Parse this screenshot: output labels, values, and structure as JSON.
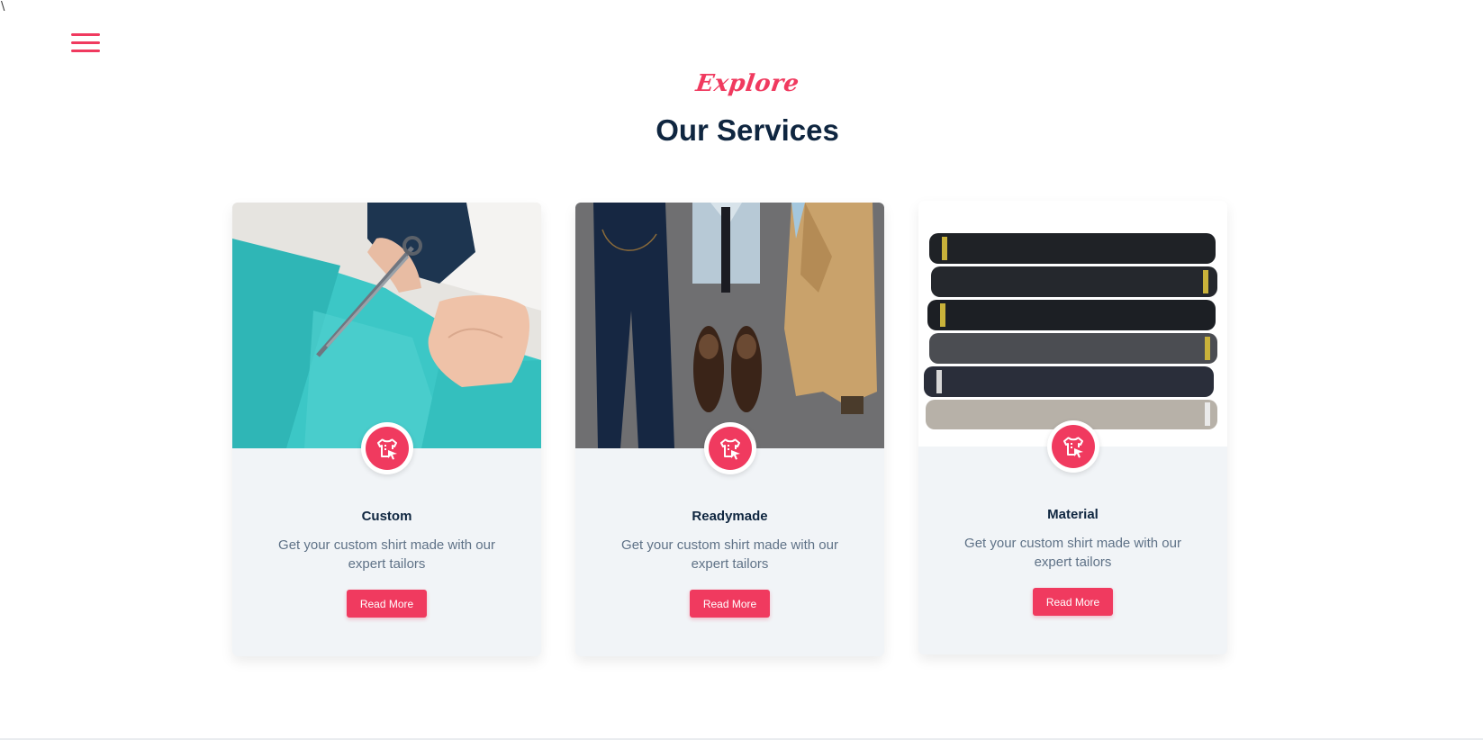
{
  "stray_mark": "\\",
  "nav": {
    "menu_icon": "hamburger-menu-icon"
  },
  "section": {
    "eyebrow": "Explore",
    "title": "Our Services"
  },
  "services": [
    {
      "title": "Custom",
      "description": "Get your custom shirt made with our expert tailors",
      "button": "Read More",
      "icon": "tailored-shirt-icon"
    },
    {
      "title": "Readymade",
      "description": "Get your custom shirt made with our expert tailors",
      "button": "Read More",
      "icon": "tailored-shirt-icon"
    },
    {
      "title": "Material",
      "description": "Get your custom shirt made with our expert tailors",
      "button": "Read More",
      "icon": "tailored-shirt-icon"
    }
  ],
  "colors": {
    "accent": "#f03a5f",
    "heading": "#0f2640",
    "body_text": "#5f7287",
    "card_bg": "#f1f4f7"
  }
}
